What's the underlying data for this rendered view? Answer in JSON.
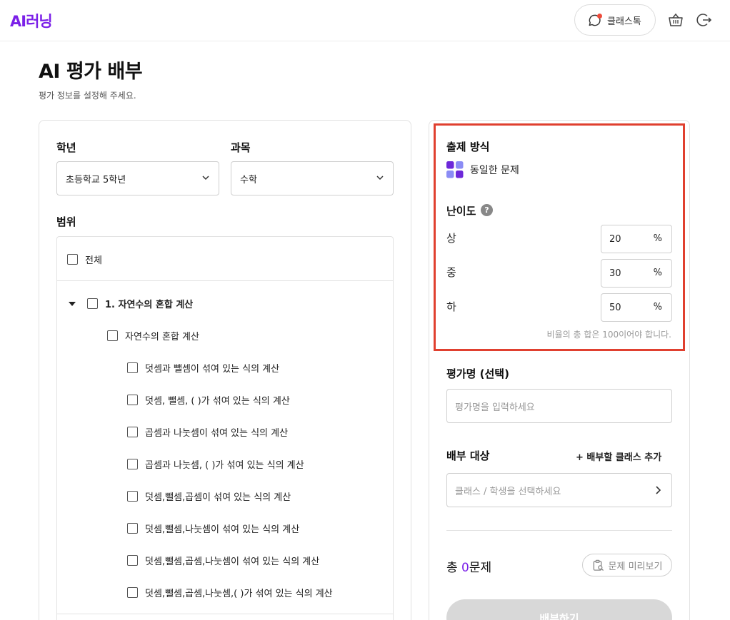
{
  "header": {
    "logo": "AI러닝",
    "classtalk_label": "클래스톡",
    "icons": [
      "chat-bubble-icon",
      "basket-icon",
      "logout-icon"
    ]
  },
  "page": {
    "title": "AI 평가 배부",
    "subtitle": "평가 정보를 설정해 주세요."
  },
  "left": {
    "grade_label": "학년",
    "grade_value": "초등학교 5학년",
    "subject_label": "과목",
    "subject_value": "수학",
    "range_label": "범위",
    "all_label": "전체",
    "unit_label": "1. 자연수의 혼합 계산",
    "sub_unit_label": "자연수의 혼합 계산",
    "topics": [
      "덧셈과 뺄셈이 섞여 있는 식의 계산",
      "덧셈, 뺄셈, ( )가 섞여 있는 식의 계산",
      "곱셈과 나눗셈이 섞여 있는 식의 계산",
      "곱셈과 나눗셈, ( )가 섞여 있는 식의 계산",
      "덧셈,뺄셈,곱셈이 섞여 있는 식의 계산",
      "덧셈,뺄셈,나눗셈이 섞여 있는 식의 계산",
      "덧셈,뺄셈,곱셈,나눗셈이 섞여 있는 식의 계산",
      "덧셈,뺄셈,곱셈,나눗셈,( )가 섞여 있는 식의 계산"
    ]
  },
  "right": {
    "method_label": "출제 방식",
    "method_value": "동일한 문제",
    "difficulty_label": "난이도",
    "help_symbol": "?",
    "levels": [
      {
        "label": "상",
        "value": "20",
        "unit": "%"
      },
      {
        "label": "중",
        "value": "30",
        "unit": "%"
      },
      {
        "label": "하",
        "value": "50",
        "unit": "%"
      }
    ],
    "ratio_note": "비율의 총 합은 100이어야 합니다.",
    "eval_name_label": "평가명 (선택)",
    "eval_name_placeholder": "평가명을 입력하세요",
    "target_label": "배부 대상",
    "add_class_label": "+ 배부할 클래스 추가",
    "target_placeholder": "클래스 / 학생을 선택하세요",
    "total_prefix": "총 ",
    "total_count": "0",
    "total_suffix": "문제",
    "preview_label": "문제 미리보기",
    "deploy_label": "배부하기"
  },
  "colors": {
    "brand": "#7b20e8",
    "highlight": "#e0402f",
    "notification": "#ee4a3a"
  }
}
